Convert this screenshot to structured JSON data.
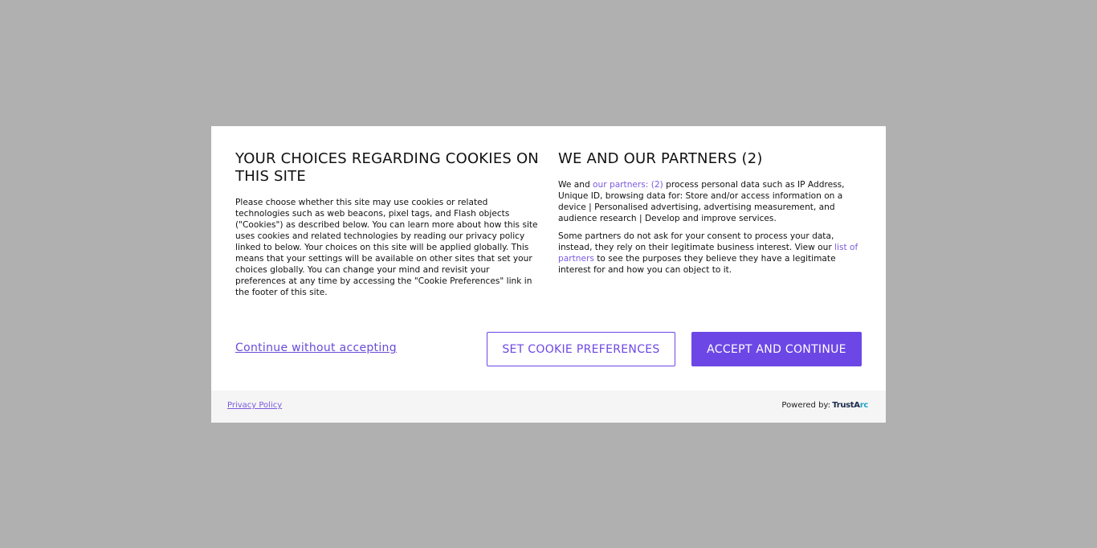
{
  "left": {
    "title": "YOUR CHOICES REGARDING COOKIES ON THIS SITE",
    "body": "Please choose whether this site may use cookies or related technologies such as web beacons, pixel tags, and Flash objects (\"Cookies\") as described below. You can learn more about how this site uses cookies and related technologies by reading our privacy policy linked to below. Your choices on this site will be applied globally. This means that your settings will be available on other sites that set your choices globally. You can change your mind and revisit your preferences at any time by accessing the \"Cookie Preferences\" link in the footer of this site."
  },
  "right": {
    "title": "WE AND OUR PARTNERS (2)",
    "p1_before": "We and ",
    "p1_link": "our partners: (2)",
    "p1_after": " process personal data such as IP Address, Unique ID, browsing data for: Store and/or access information on a device | Personalised advertising, advertising measurement, and audience research | Develop and improve services.",
    "p2_before": "Some partners do not ask for your consent to process your data, instead, they rely on their legitimate business interest. View our ",
    "p2_link": "list of partners",
    "p2_after": " to see the purposes they believe they have a legitimate interest for and how you can object to it."
  },
  "actions": {
    "continue_without": "Continue without accepting",
    "set_preferences": "SET COOKIE PREFERENCES",
    "accept": "ACCEPT AND CONTINUE"
  },
  "footer": {
    "privacy_policy": "Privacy Policy",
    "powered_by": "Powered by:",
    "logo_part1": "TrustA",
    "logo_part2": "rc"
  },
  "colors": {
    "accent": "#6c47e6",
    "link": "#7a5ae0",
    "overlay": "#b0b0b0"
  }
}
